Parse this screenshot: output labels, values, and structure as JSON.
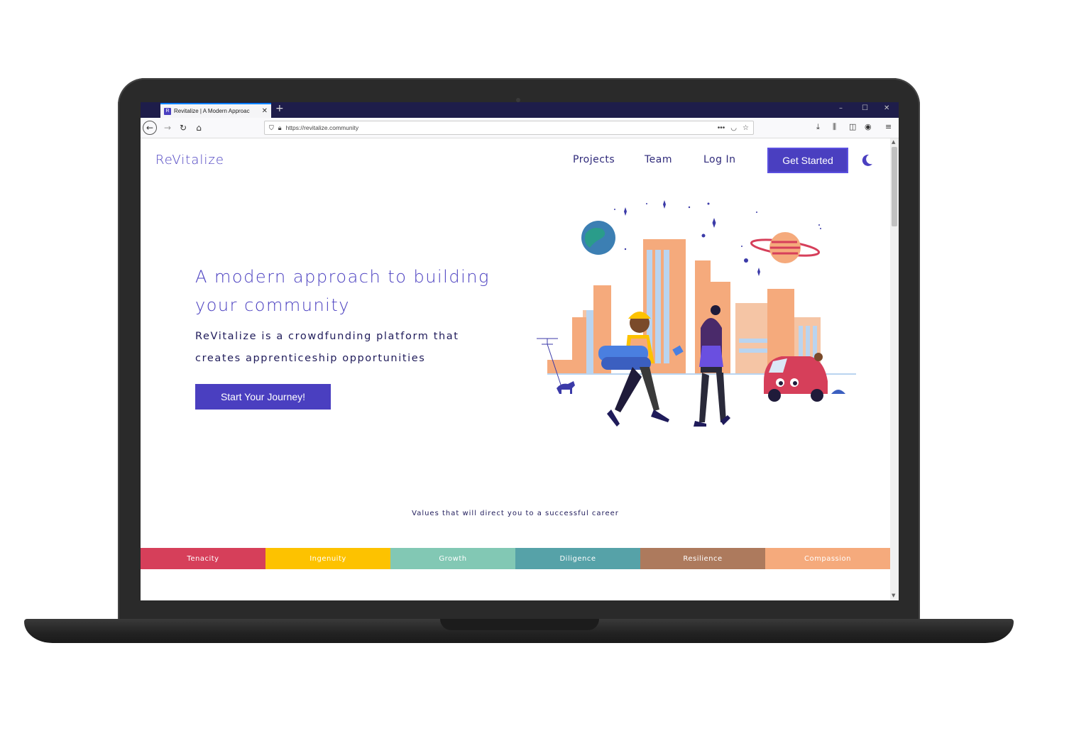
{
  "browser": {
    "tab_title": "Revitalize | A Modern Approac",
    "tab_favicon_letter": "R",
    "url": "https://revitalize.community"
  },
  "site": {
    "brand": "ReVitalize",
    "nav": {
      "projects": "Projects",
      "team": "Team",
      "login": "Log In",
      "get_started": "Get Started"
    },
    "hero": {
      "title": "A modern approach to building your community",
      "subtitle": "ReVitalize is a crowdfunding platform that creates apprenticeship opportunities",
      "cta": "Start Your Journey!"
    },
    "values": {
      "caption": "Values that will direct you to a successful career",
      "items": [
        {
          "label": "Tenacity",
          "color": "#d63f5a"
        },
        {
          "label": "Ingenuity",
          "color": "#fdc200"
        },
        {
          "label": "Growth",
          "color": "#82c8b4"
        },
        {
          "label": "Diligence",
          "color": "#56a2a8"
        },
        {
          "label": "Resilience",
          "color": "#ad7a5d"
        },
        {
          "label": "Compassion",
          "color": "#f5aa7c"
        }
      ]
    }
  },
  "colors": {
    "primary": "#4a3fc0",
    "dark_text": "#1f1b5a"
  }
}
